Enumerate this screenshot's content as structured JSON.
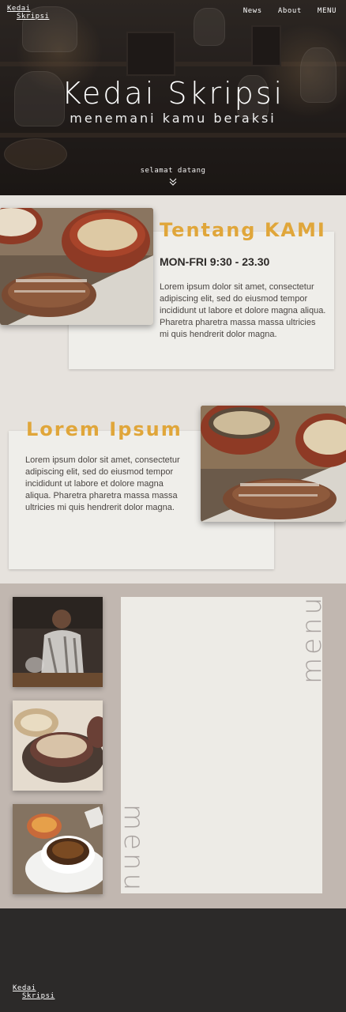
{
  "brand": {
    "line1": "Kedai",
    "line2": "Skripsi"
  },
  "nav": {
    "items": [
      "News",
      "About",
      "MENU"
    ]
  },
  "hero": {
    "title": "Kedai Skripsi",
    "subtitle": "menemani kamu beraksi",
    "welcome": "selamat datang"
  },
  "about": {
    "title": "Tentang KAMI",
    "hours": "MON-FRI 9:30 - 23.30",
    "text": "Lorem ipsum dolor sit amet, consectetur adipiscing elit, sed do eiusmod tempor incididunt ut labore et dolore magna aliqua. Pharetra pharetra massa massa ultricies mi quis hendrerit dolor magna."
  },
  "lorem": {
    "title": "Lorem Ipsum",
    "text": "Lorem ipsum dolor sit amet, consectetur adipiscing elit, sed do eiusmod tempor incididunt ut labore et dolore magna aliqua. Pharetra pharetra massa massa ultricies mi quis hendrerit dolor magna."
  },
  "menu": {
    "label_top": "menu",
    "label_bottom": "menu"
  },
  "footer": {
    "line1": "Kedai",
    "line2": "Skripsi"
  },
  "colors": {
    "accent": "#e0a63a",
    "hero_dark": "#2a2523",
    "menu_bg": "#c1b7b0",
    "footer_bg": "#2c2a29",
    "page_bg": "#e6e2dd"
  }
}
